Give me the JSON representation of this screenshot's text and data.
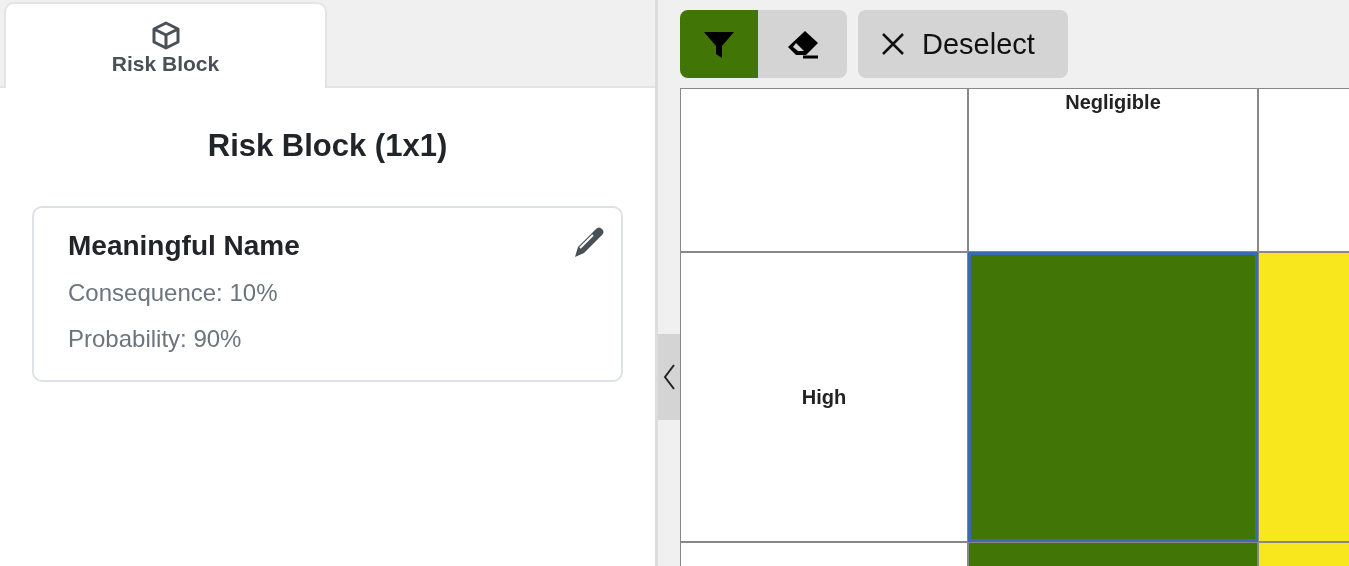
{
  "tabs": [
    {
      "label": "Risk Block",
      "selected": true
    }
  ],
  "panel": {
    "title": "Risk Block (1x1)",
    "card": {
      "name": "Meaningful Name",
      "lines": [
        "Consequence: 10%",
        "Probability: 90%"
      ]
    }
  },
  "toolbar": {
    "tools": [
      {
        "kind": "filter",
        "selected": true
      },
      {
        "kind": "eraser",
        "selected": false
      }
    ],
    "deselect": {
      "label": "Deselect"
    }
  },
  "matrix": {
    "rows": [
      [
        {
          "kind": "blank"
        },
        {
          "kind": "col-label",
          "text": "Negligible"
        },
        {
          "kind": "blank"
        }
      ],
      [
        {
          "kind": "row-label",
          "text": "High"
        },
        {
          "kind": "risk",
          "color": "#417505",
          "selected": true
        },
        {
          "kind": "risk",
          "color": "#f8e71c",
          "selected": false
        }
      ],
      [
        {
          "kind": "blank"
        },
        {
          "kind": "risk",
          "color": "#417505",
          "selected": false
        },
        {
          "kind": "risk",
          "color": "#f8e71c",
          "selected": false
        }
      ]
    ]
  }
}
